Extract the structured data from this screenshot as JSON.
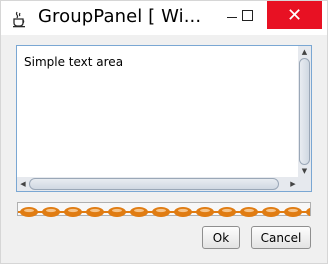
{
  "window": {
    "title": "GroupPanel [ Wi...",
    "close_glyph": "✕"
  },
  "textarea": {
    "value": "Simple text area"
  },
  "scrollbars": {
    "up_arrow": "▲",
    "down_arrow": "▼",
    "left_arrow": "◀",
    "right_arrow": "▶"
  },
  "progress": {
    "indeterminate": true,
    "color": "#e07c12"
  },
  "buttons": {
    "ok_label": "Ok",
    "cancel_label": "Cancel"
  },
  "colors": {
    "close_bg": "#e81123",
    "focus_border": "#7aa7d3",
    "progress_accent": "#e07c12"
  }
}
